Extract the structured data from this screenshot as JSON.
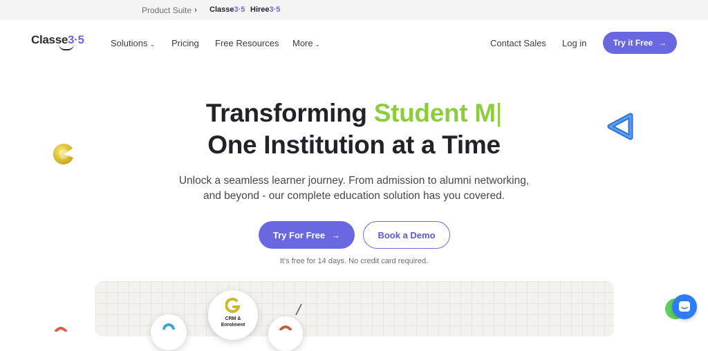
{
  "topbar": {
    "suite_label": "Product Suite",
    "products": [
      {
        "name_main": "Classe",
        "name_accent": "3·5"
      },
      {
        "name_main": "Hiree",
        "name_accent": "3·5"
      }
    ]
  },
  "nav": {
    "logo_main": "Classe",
    "logo_accent": "3·5",
    "links": [
      {
        "label": "Solutions",
        "has_dropdown": true
      },
      {
        "label": "Pricing",
        "has_dropdown": false
      },
      {
        "label": "Free Resources",
        "has_dropdown": false
      },
      {
        "label": "More",
        "has_dropdown": true
      }
    ],
    "contact_sales": "Contact Sales",
    "login": "Log in",
    "try_free": "Try it Free"
  },
  "hero": {
    "title_prefix": "Transforming ",
    "title_typed": "Student M",
    "title_cursor": "|",
    "title_line2": "One Institution at a Time",
    "subtitle_line1": "Unlock a seamless learner journey. From admission to alumni networking,",
    "subtitle_line2": "and beyond - our complete education solution has you covered.",
    "cta_primary": "Try For Free",
    "cta_secondary": "Book a Demo",
    "note": "It's free for 14 days. No credit card required."
  },
  "preview": {
    "crm_label_line1": "CRM &",
    "crm_label_line2": "Enrolment"
  },
  "colors": {
    "accent": "#6a68e0",
    "highlight_green": "#8ccd3c",
    "chat_blue": "#2e7df6"
  },
  "icons": [
    "chevron-right-icon",
    "chevron-down-icon",
    "arrow-right-icon",
    "pacman-shape-icon",
    "triangle-shape-icon",
    "crm-icon",
    "chat-icon"
  ]
}
